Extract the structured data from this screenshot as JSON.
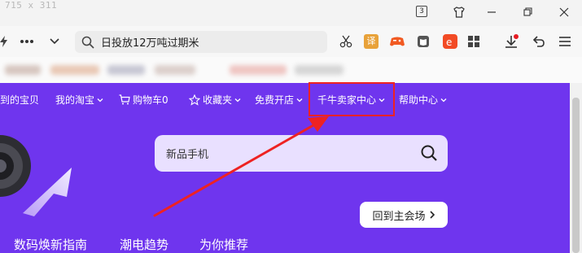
{
  "window": {
    "dim_label": "715 x 311",
    "tab_count": "3"
  },
  "address_bar": {
    "text": "日投放12万吨过期米"
  },
  "nav": {
    "items": [
      {
        "label": "到的宝贝",
        "has_caret": false
      },
      {
        "label": "我的淘宝",
        "has_caret": true
      },
      {
        "label": "购物车0",
        "has_caret": false
      },
      {
        "label": "收藏夹",
        "has_caret": true
      },
      {
        "label": "免费开店",
        "has_caret": true
      },
      {
        "label": "千牛卖家中心",
        "has_caret": true
      },
      {
        "label": "帮助中心",
        "has_caret": true
      }
    ]
  },
  "search": {
    "placeholder": "新品手机"
  },
  "back_button": {
    "label": "回到主会场"
  },
  "bottom_tabs": [
    {
      "label": "数码焕新指南"
    },
    {
      "label": "潮电趋势"
    },
    {
      "label": "为你推荐"
    }
  ],
  "colors": {
    "brand_purple": "#6f35ee",
    "annotation_red": "#ee2222"
  }
}
